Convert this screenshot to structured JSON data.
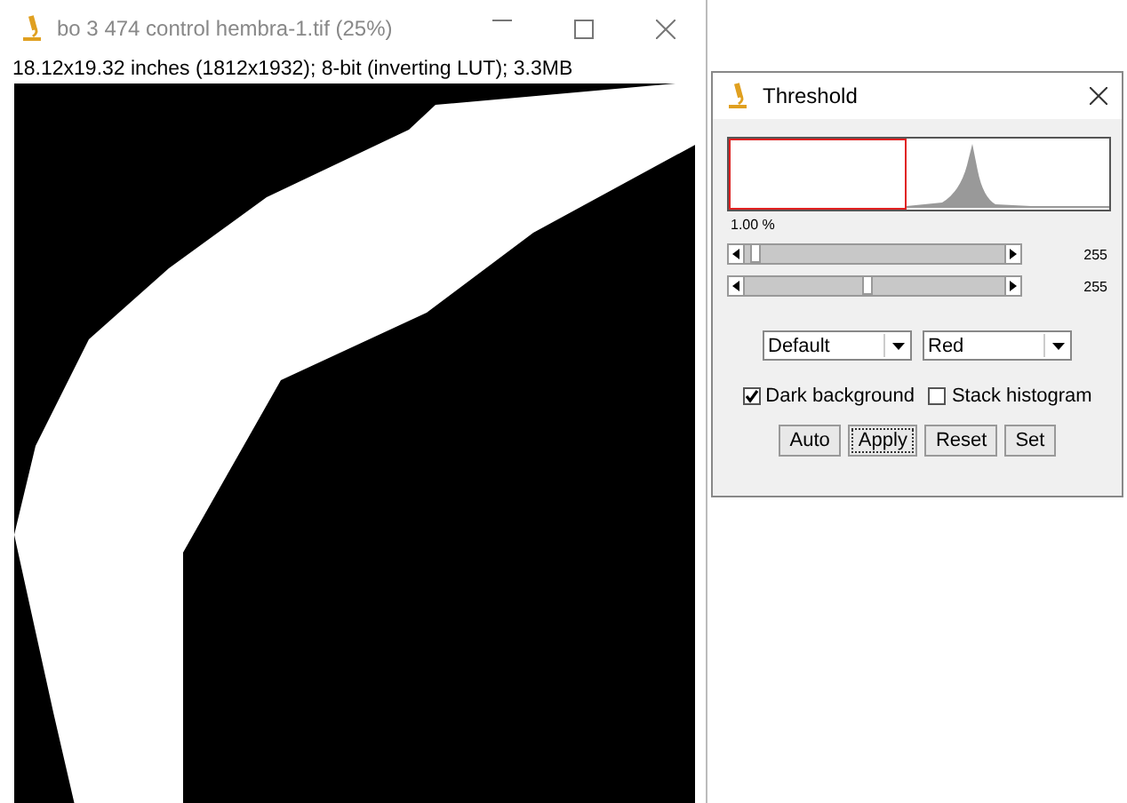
{
  "image_window": {
    "title": "bo 3 474 control hembra-1.tif (25%)",
    "info": "18.12x19.32 inches (1812x1932); 8-bit (inverting LUT); 3.3MB"
  },
  "threshold": {
    "title": "Threshold",
    "percent": "1.00 %",
    "sliders": [
      {
        "level": 0.02,
        "reading": "255"
      },
      {
        "level": 0.47,
        "reading": "255"
      }
    ],
    "dropdowns": [
      {
        "value": "Default"
      },
      {
        "value": "Red"
      }
    ],
    "checkboxes": [
      {
        "label": "Dark background",
        "checked": true
      },
      {
        "label": "Stack histogram",
        "checked": false
      }
    ],
    "buttons": [
      {
        "label": "Auto",
        "focused": false
      },
      {
        "label": "Apply",
        "focused": true
      },
      {
        "label": "Reset",
        "focused": false
      },
      {
        "label": "Set",
        "focused": false
      }
    ]
  }
}
